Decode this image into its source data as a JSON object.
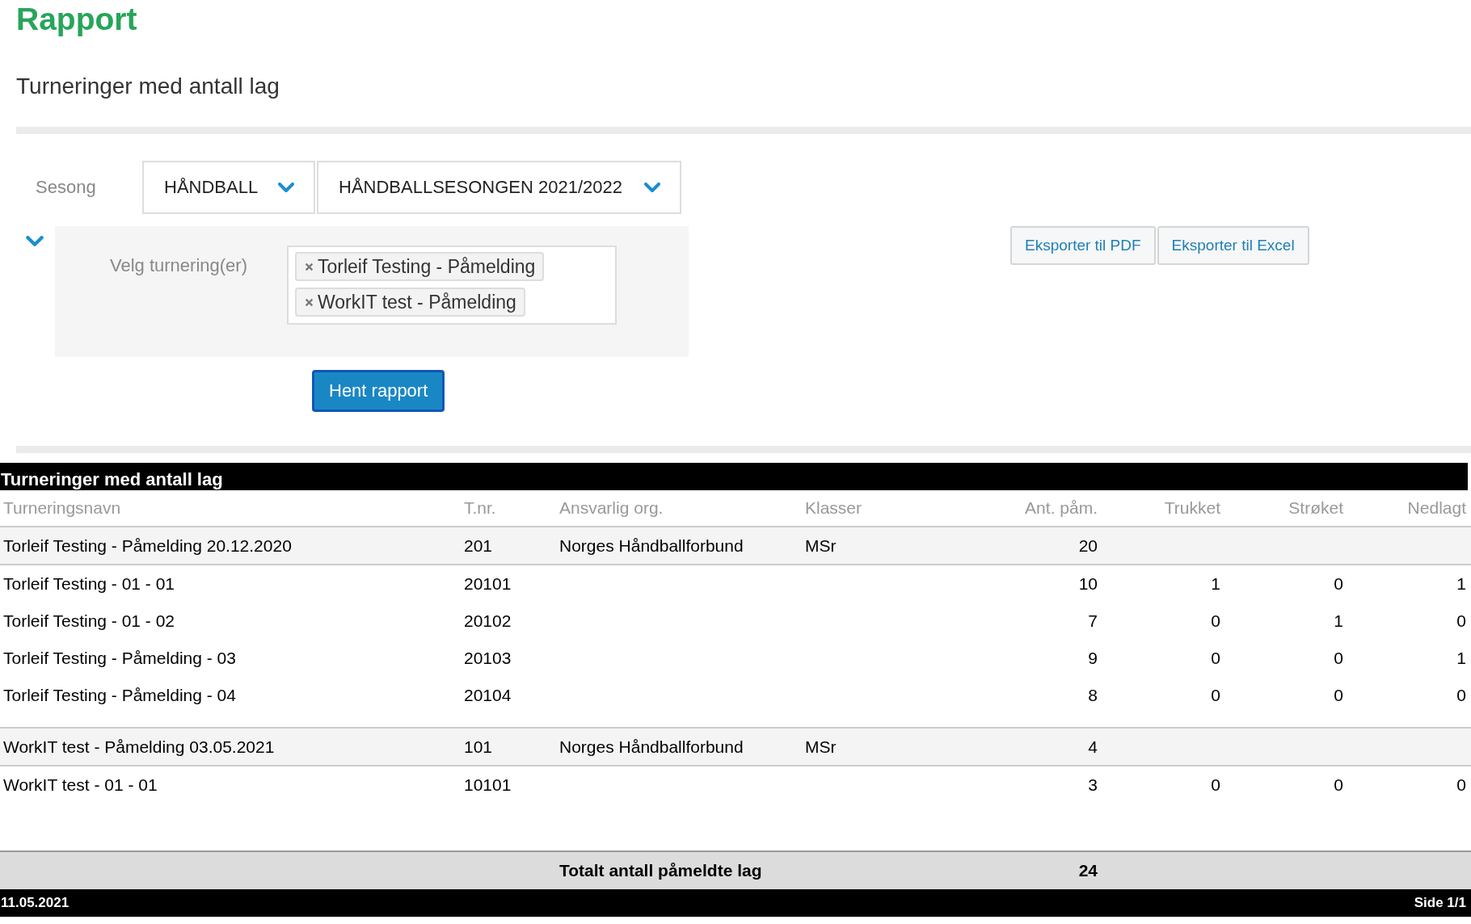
{
  "page_title": "Rapport",
  "report_title": "Turneringer med antall lag",
  "filters": {
    "season_label": "Sesong",
    "sport": "HÅNDBALL",
    "season": "HÅNDBALLSESONGEN 2021/2022",
    "panel_expanded": true,
    "tournament_label": "Velg turnering(er)",
    "selected_tournaments": [
      "Torleif Testing - Påmelding",
      "WorkIT test - Påmelding"
    ],
    "submit": "Hent rapport"
  },
  "exports": [
    "Eksporter til PDF",
    "Eksporter til Excel"
  ],
  "report": {
    "title": "Turneringer med antall lag",
    "columns": [
      "Turneringsnavn",
      "T.nr.",
      "Ansvarlig org.",
      "Klasser",
      "Ant. påm.",
      "Trukket",
      "Strøket",
      "Nedlagt"
    ],
    "groups": [
      {
        "tournament": {
          "name": "Torleif Testing - Påmelding 20.12.2020",
          "nr": "201",
          "org": "Norges Håndballforbund",
          "classes": "MSr",
          "count": "20"
        },
        "classes": [
          {
            "name": "Torleif Testing - 01 - 01",
            "nr": "20101",
            "count": "10",
            "withdrawn": "1",
            "struck": "0",
            "dropped": "1"
          },
          {
            "name": "Torleif Testing - 01 - 02",
            "nr": "20102",
            "count": "7",
            "withdrawn": "0",
            "struck": "1",
            "dropped": "0"
          },
          {
            "name": "Torleif Testing - Påmelding - 03",
            "nr": "20103",
            "count": "9",
            "withdrawn": "0",
            "struck": "0",
            "dropped": "1"
          },
          {
            "name": "Torleif Testing - Påmelding - 04",
            "nr": "20104",
            "count": "8",
            "withdrawn": "0",
            "struck": "0",
            "dropped": "0"
          }
        ]
      },
      {
        "tournament": {
          "name": "WorkIT test - Påmelding 03.05.2021",
          "nr": "101",
          "org": "Norges Håndballforbund",
          "classes": "MSr",
          "count": "4"
        },
        "classes": [
          {
            "name": "WorkIT test - 01 - 01",
            "nr": "10101",
            "count": "3",
            "withdrawn": "0",
            "struck": "0",
            "dropped": "0"
          }
        ]
      }
    ],
    "total_label": "Totalt antall påmeldte lag",
    "total": "24",
    "date": "11.05.2021",
    "page": "Side 1/1"
  }
}
